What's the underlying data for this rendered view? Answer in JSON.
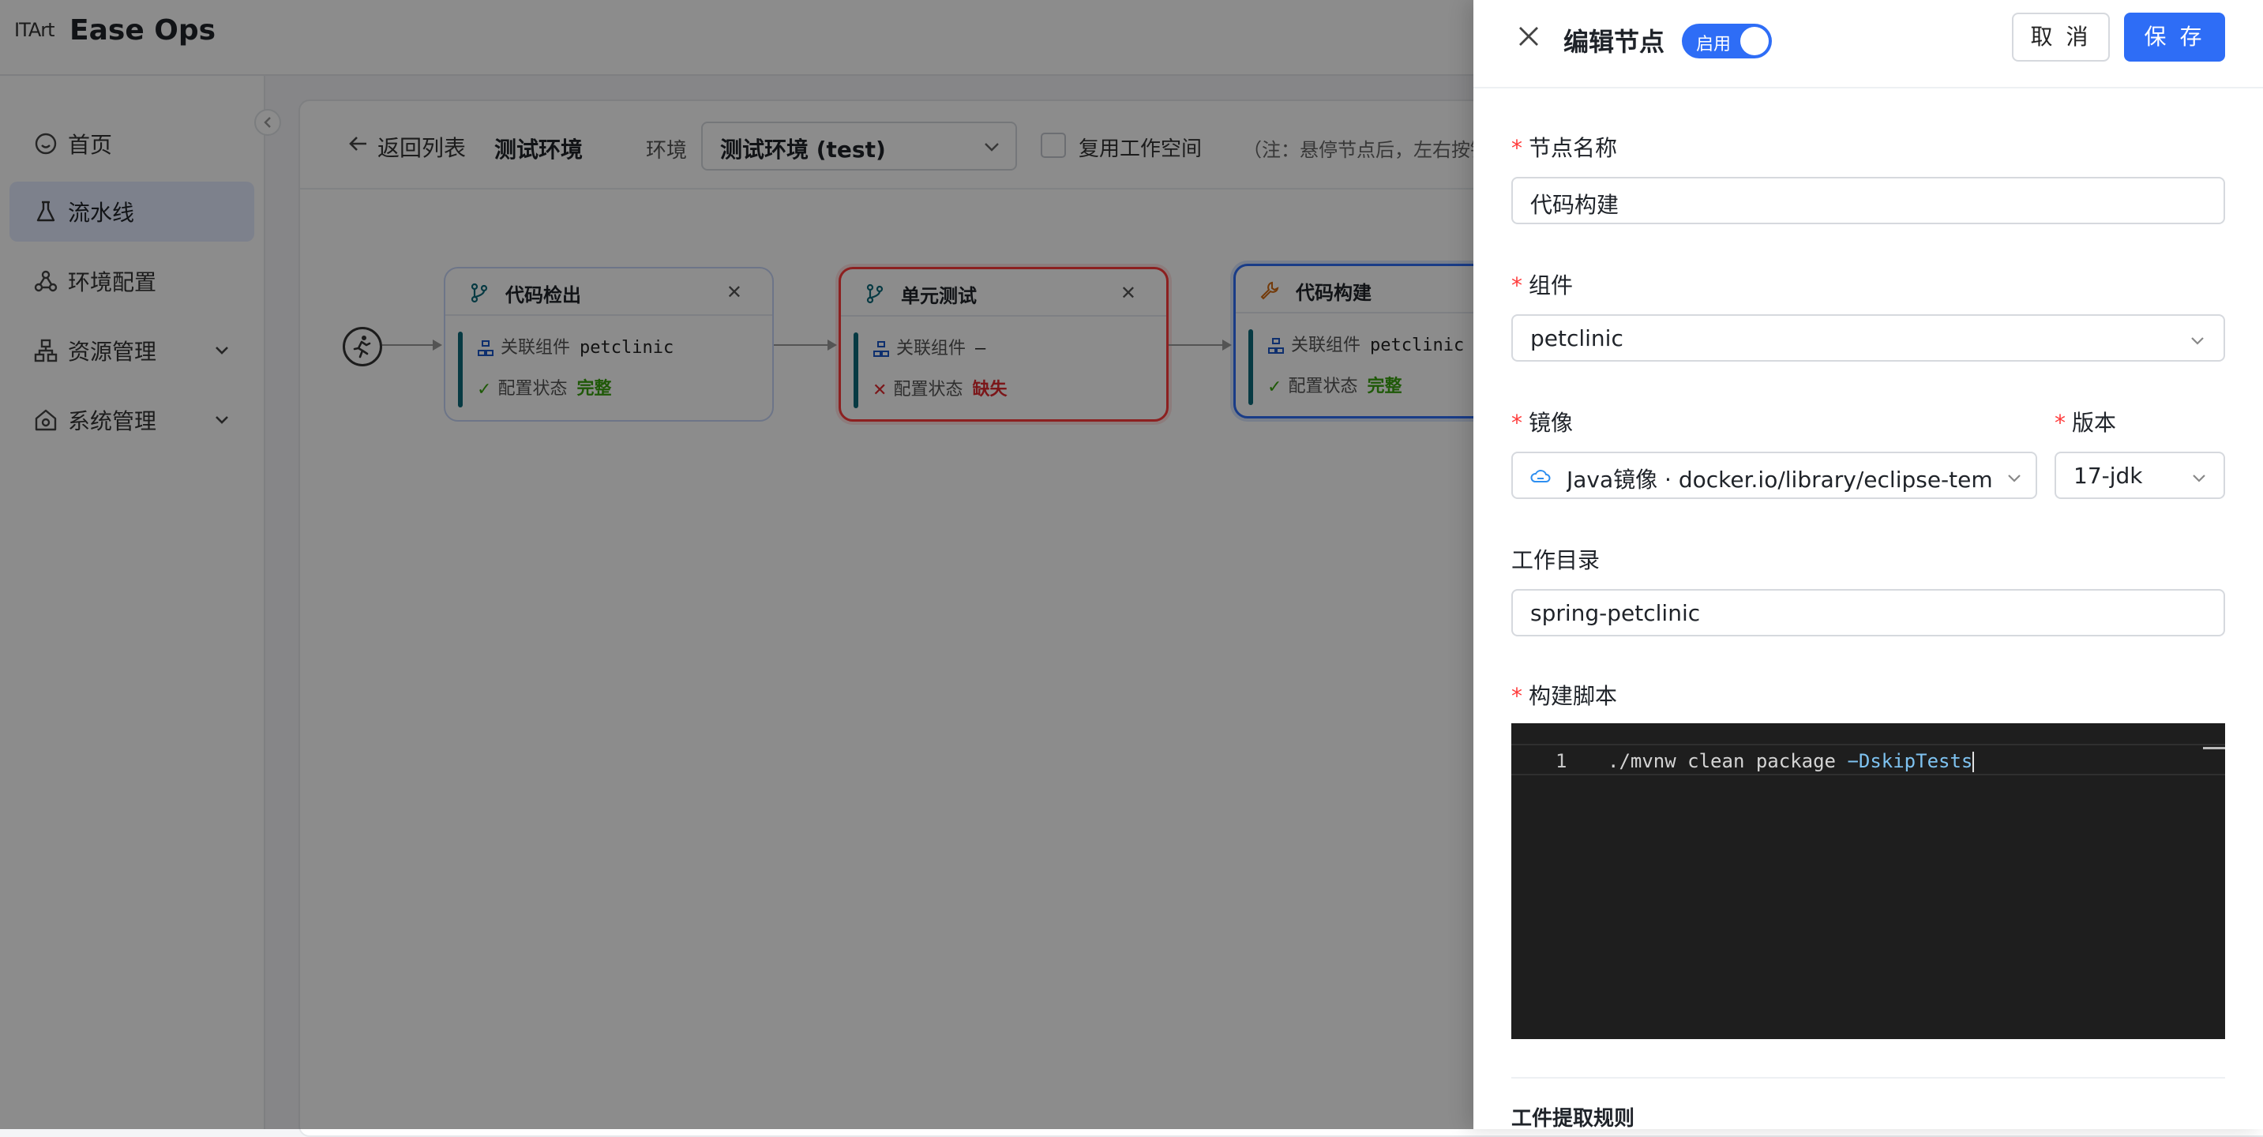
{
  "app": {
    "logo_text": "ITArt",
    "title": "Ease Ops"
  },
  "sidebar": {
    "items": [
      {
        "label": "首页",
        "icon": "smile-icon"
      },
      {
        "label": "流水线",
        "icon": "flask-icon",
        "active": true
      },
      {
        "label": "环境配置",
        "icon": "nodes-icon"
      },
      {
        "label": "资源管理",
        "icon": "sitemap-icon",
        "expandable": true
      },
      {
        "label": "系统管理",
        "icon": "home-gear-icon",
        "expandable": true
      }
    ]
  },
  "toolbar": {
    "back_label": "返回列表",
    "env_name": "测试环境",
    "env_label": "环境",
    "env_selected": "测试环境 (test)",
    "reuse_label": "复用工作空间",
    "note": "（注：悬停节点后，左右按钮"
  },
  "pipeline": {
    "nodes": [
      {
        "title": "代码检出",
        "component_label": "关联组件",
        "component": "petclinic",
        "status_label": "配置状态",
        "status": "完整",
        "state": "normal"
      },
      {
        "title": "单元测试",
        "component_label": "关联组件",
        "component": "–",
        "status_label": "配置状态",
        "status": "缺失",
        "state": "error"
      },
      {
        "title": "代码构建",
        "component_label": "关联组件",
        "component": "petclinic",
        "status_label": "配置状态",
        "status": "完整",
        "state": "selected"
      }
    ]
  },
  "drawer": {
    "title": "编辑节点",
    "toggle_label": "启用",
    "toggle_on": true,
    "cancel_label": "取 消",
    "save_label": "保 存",
    "fields": {
      "node_name": {
        "label": "节点名称",
        "value": "代码构建"
      },
      "component": {
        "label": "组件",
        "value": "petclinic"
      },
      "image": {
        "label": "镜像",
        "value": "Java镜像 · docker.io/library/eclipse-temu"
      },
      "version": {
        "label": "版本",
        "value": "17-jdk"
      },
      "workdir": {
        "label": "工作目录",
        "value": "spring-petclinic"
      },
      "script": {
        "label": "构建脚本",
        "line_no": "1",
        "code_main": "./mvnw clean package ",
        "code_flag": "−DskipTests"
      }
    },
    "next_section": "工件提取规则"
  },
  "colors": {
    "primary": "#2e6df6",
    "error": "#ff3b3b",
    "success": "#3aa310",
    "editor_bg": "#1e1e1e"
  }
}
